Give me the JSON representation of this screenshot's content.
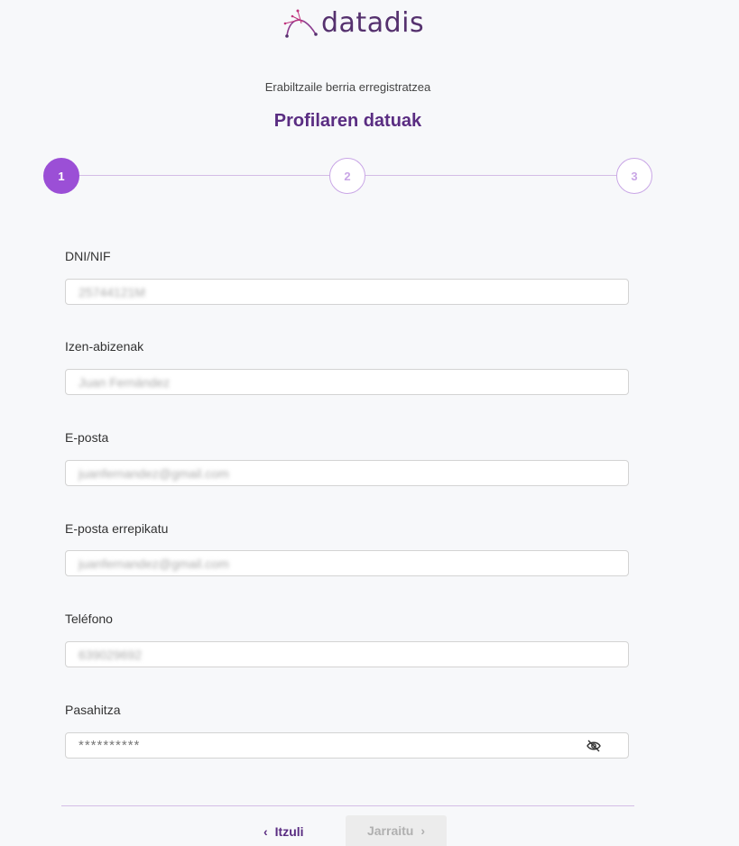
{
  "brand": {
    "name": "datadis"
  },
  "header": {
    "subtitle": "Erabiltzaile berria erregistratzea",
    "title": "Profilaren datuak"
  },
  "stepper": {
    "steps": [
      "1",
      "2",
      "3"
    ],
    "active": 1
  },
  "form": {
    "dni": {
      "label": "DNI/NIF",
      "value": "25744121M"
    },
    "name": {
      "label": "Izen-abizenak",
      "value": "Juan Fernández"
    },
    "email": {
      "label": "E-posta",
      "value": "juanfernandez@gmail.com"
    },
    "email_repeat": {
      "label": "E-posta errepikatu",
      "value": "juanfernandez@gmail.com"
    },
    "phone": {
      "label": "Teléfono",
      "value": "639029692"
    },
    "password": {
      "label": "Pasahitza",
      "value": "**********"
    }
  },
  "footer": {
    "back_label": "Itzuli",
    "next_label": "Jarraitu"
  },
  "colors": {
    "primary": "#5a2d82",
    "accent": "#9b4fd6",
    "step_inactive": "#c9a6e6"
  }
}
